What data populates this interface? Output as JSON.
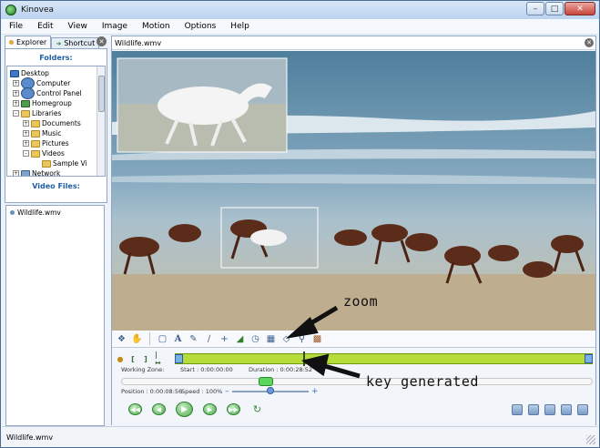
{
  "window": {
    "title": "Kinovea"
  },
  "menu": [
    "File",
    "Edit",
    "View",
    "Image",
    "Motion",
    "Options",
    "Help"
  ],
  "left": {
    "tabs": [
      {
        "label": "Explorer"
      },
      {
        "label": "Shortcut"
      }
    ],
    "folders_header": "Folders:",
    "tree": [
      {
        "label": "Desktop",
        "icon": "desktop-icon"
      },
      {
        "label": "Computer",
        "icon": "computer-icon"
      },
      {
        "label": "Control Panel",
        "icon": "control-panel-icon"
      },
      {
        "label": "Homegroup",
        "icon": "homegroup-icon"
      },
      {
        "label": "Libraries",
        "icon": "folder-icon"
      },
      {
        "label": "Documents",
        "icon": "folder-icon"
      },
      {
        "label": "Music",
        "icon": "folder-icon"
      },
      {
        "label": "Pictures",
        "icon": "folder-icon"
      },
      {
        "label": "Videos",
        "icon": "folder-icon"
      },
      {
        "label": "Sample Vi",
        "icon": "folder-icon"
      },
      {
        "label": "Network",
        "icon": "network-icon"
      }
    ],
    "videos_header": "Video Files:",
    "videos": [
      "Wildlife.wmv"
    ]
  },
  "player": {
    "file_tab": "Wildlife.wmv",
    "working_zone_label": "Working Zone:",
    "start_label": "Start : 0:00:00:00",
    "duration_label": "Duration : 0:00:28:52",
    "position_label": "Position : 0:00:08:56",
    "speed_label": "Speed : 100%"
  },
  "annotations": {
    "zoom": "zoom",
    "key": "key generated"
  },
  "status": {
    "text": "Wildlife.wmv"
  },
  "colors": {
    "timeline": "#b6dc3a",
    "accent": "#1f5fa8"
  }
}
